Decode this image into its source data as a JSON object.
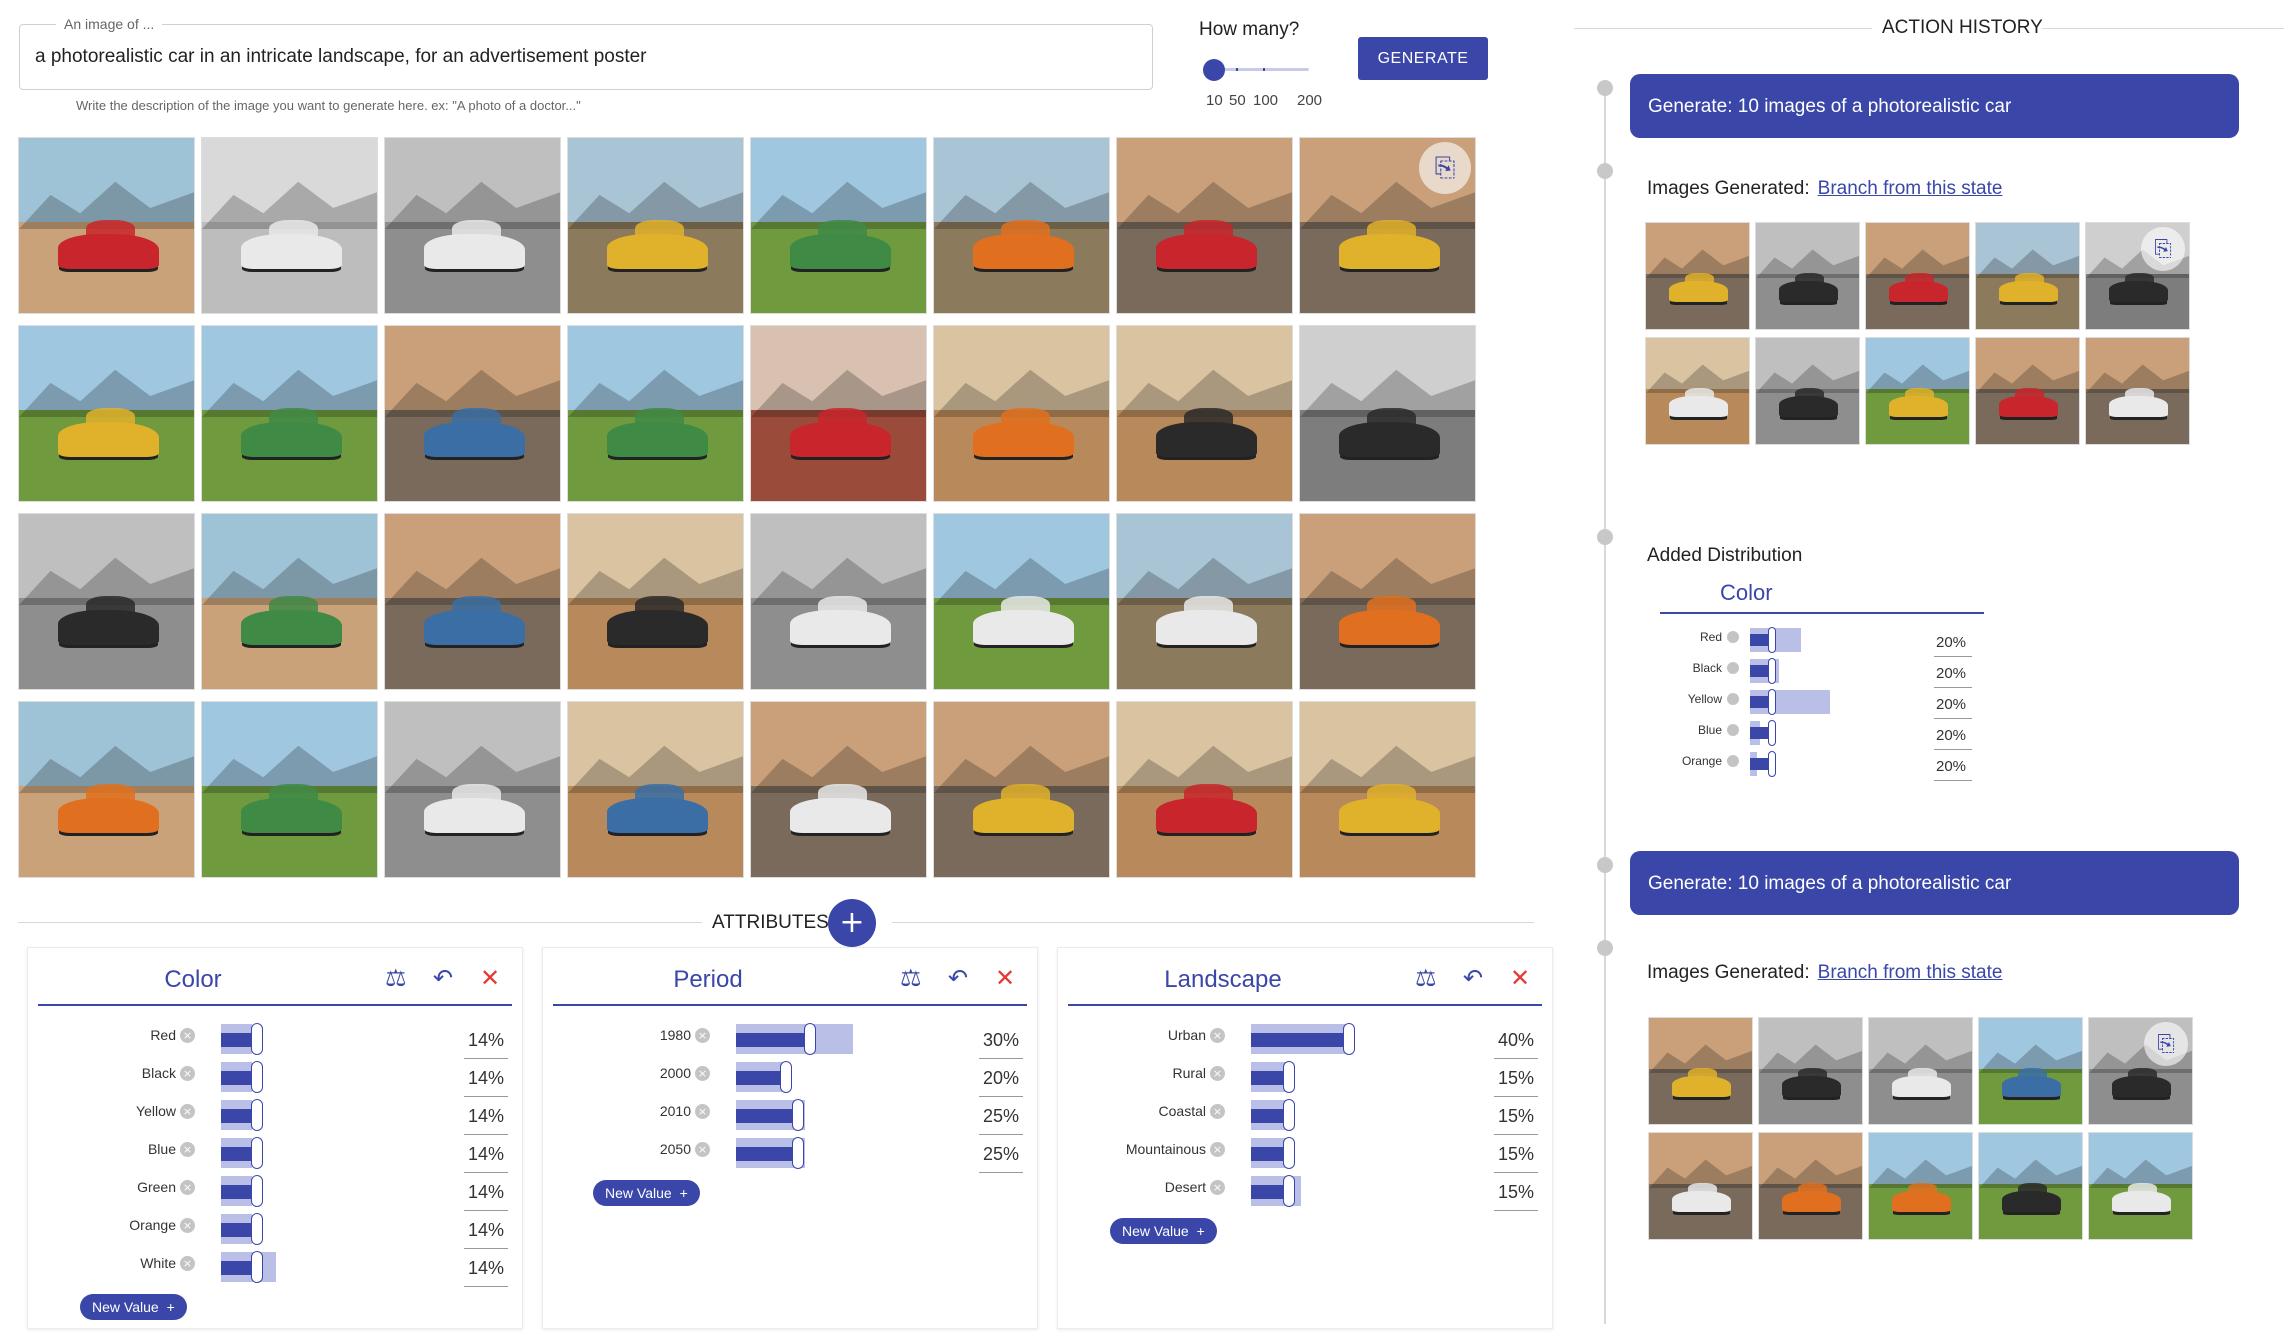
{
  "prompt": {
    "legend": "An image of ...",
    "value": "a photorealistic car in an intricate landscape, for an advertisement poster",
    "helper": "Write the description of the image you want to generate here. ex: \"A photo of a doctor...\""
  },
  "how_many": {
    "label": "How many?",
    "value": 10,
    "tick_labels": [
      "10",
      "50",
      "100",
      "200"
    ]
  },
  "generate_label": "GENERATE",
  "grid_images": [
    {
      "car": "red",
      "scene": "coast"
    },
    {
      "car": "white",
      "scene": "desert-bw"
    },
    {
      "car": "white",
      "scene": "city-bw"
    },
    {
      "car": "yellow",
      "scene": "mountain"
    },
    {
      "car": "green",
      "scene": "field"
    },
    {
      "car": "orange",
      "scene": "mountain"
    },
    {
      "car": "red",
      "scene": "city"
    },
    {
      "car": "yellow",
      "scene": "city"
    },
    {
      "car": "yellow",
      "scene": "field"
    },
    {
      "car": "green",
      "scene": "field"
    },
    {
      "car": "blue",
      "scene": "city"
    },
    {
      "car": "green",
      "scene": "field"
    },
    {
      "car": "red",
      "scene": "clouds"
    },
    {
      "car": "orange",
      "scene": "desert"
    },
    {
      "car": "black",
      "scene": "desert"
    },
    {
      "car": "black",
      "scene": "mountain-bw"
    },
    {
      "car": "black",
      "scene": "city-bw"
    },
    {
      "car": "green",
      "scene": "coast"
    },
    {
      "car": "blue",
      "scene": "city"
    },
    {
      "car": "black",
      "scene": "desert"
    },
    {
      "car": "white",
      "scene": "city-bw"
    },
    {
      "car": "white",
      "scene": "field"
    },
    {
      "car": "white",
      "scene": "mountain"
    },
    {
      "car": "orange",
      "scene": "city"
    },
    {
      "car": "orange",
      "scene": "coast"
    },
    {
      "car": "green",
      "scene": "field"
    },
    {
      "car": "white",
      "scene": "city-bw"
    },
    {
      "car": "blue",
      "scene": "desert"
    },
    {
      "car": "white",
      "scene": "city"
    },
    {
      "car": "yellow",
      "scene": "city"
    },
    {
      "car": "red",
      "scene": "desert"
    },
    {
      "car": "yellow",
      "scene": "desert"
    }
  ],
  "attributes": {
    "title": "ATTRIBUTES",
    "add_icon": "plus-icon",
    "new_value_label": "New Value",
    "panels": [
      {
        "name": "Color",
        "rows": [
          {
            "label": "Red",
            "pct": "14%",
            "value": 14
          },
          {
            "label": "Black",
            "pct": "14%",
            "value": 14
          },
          {
            "label": "Yellow",
            "pct": "14%",
            "value": 14
          },
          {
            "label": "Blue",
            "pct": "14%",
            "value": 14
          },
          {
            "label": "Green",
            "pct": "14%",
            "value": 14
          },
          {
            "label": "Orange",
            "pct": "14%",
            "value": 14
          },
          {
            "label": "White",
            "pct": "14%",
            "value": 14
          }
        ],
        "current": [
          12,
          12,
          12,
          12,
          12,
          12,
          22
        ]
      },
      {
        "name": "Period",
        "rows": [
          {
            "label": "1980",
            "pct": "30%",
            "value": 30
          },
          {
            "label": "2000",
            "pct": "20%",
            "value": 20
          },
          {
            "label": "2010",
            "pct": "25%",
            "value": 25
          },
          {
            "label": "2050",
            "pct": "25%",
            "value": 25
          }
        ],
        "current": [
          48,
          20,
          28,
          28
        ]
      },
      {
        "name": "Landscape",
        "rows": [
          {
            "label": "Urban",
            "pct": "40%",
            "value": 40
          },
          {
            "label": "Rural",
            "pct": "15%",
            "value": 15
          },
          {
            "label": "Coastal",
            "pct": "15%",
            "value": 15
          },
          {
            "label": "Mountainous",
            "pct": "15%",
            "value": 15
          },
          {
            "label": "Desert",
            "pct": "15%",
            "value": 15
          }
        ],
        "current": [
          40,
          15,
          15,
          15,
          20
        ]
      }
    ]
  },
  "history": {
    "title": "ACTION HISTORY",
    "gen1": "Generate: 10 images of a photorealistic car",
    "images_label": "Images Generated:",
    "branch_link": "Branch from this state",
    "added_distribution": "Added Distribution",
    "dist_name": "Color",
    "dist_rows": [
      {
        "label": "Red",
        "pct": "20%",
        "value": 20,
        "current": 36
      },
      {
        "label": "Black",
        "pct": "20%",
        "value": 20,
        "current": 20
      },
      {
        "label": "Yellow",
        "pct": "20%",
        "value": 20,
        "current": 58
      },
      {
        "label": "Blue",
        "pct": "20%",
        "value": 20,
        "current": 6
      },
      {
        "label": "Orange",
        "pct": "20%",
        "value": 20,
        "current": 4
      }
    ],
    "gen2": "Generate: 10 images of a photorealistic car",
    "thumbs1": [
      {
        "car": "yellow",
        "scene": "city"
      },
      {
        "car": "black",
        "scene": "city-bw"
      },
      {
        "car": "red",
        "scene": "city"
      },
      {
        "car": "yellow",
        "scene": "mountain"
      },
      {
        "car": "black",
        "scene": "mountain-bw"
      },
      {
        "car": "white",
        "scene": "desert"
      },
      {
        "car": "black",
        "scene": "city-bw"
      },
      {
        "car": "yellow",
        "scene": "field"
      },
      {
        "car": "red",
        "scene": "city"
      },
      {
        "car": "white",
        "scene": "city"
      }
    ],
    "thumbs2": [
      {
        "car": "yellow",
        "scene": "city"
      },
      {
        "car": "black",
        "scene": "city-bw"
      },
      {
        "car": "white",
        "scene": "city-bw"
      },
      {
        "car": "blue",
        "scene": "field"
      },
      {
        "car": "black",
        "scene": "city-bw"
      },
      {
        "car": "white",
        "scene": "city"
      },
      {
        "car": "orange",
        "scene": "city"
      },
      {
        "car": "orange",
        "scene": "field"
      },
      {
        "car": "black",
        "scene": "field"
      },
      {
        "car": "white",
        "scene": "field"
      }
    ]
  },
  "icons": {
    "balance": "balance-icon",
    "undo": "undo-icon",
    "close": "close-icon",
    "copy": "copy-icon",
    "remove": "remove-value-icon"
  },
  "colors": {
    "accent": "#3a47a8",
    "accent_light": "#b9bfe6",
    "danger": "#e53935",
    "cars": {
      "red": "#c8262c",
      "white": "#e9e9e9",
      "yellow": "#e0b12a",
      "green": "#3f8a45",
      "orange": "#e0701f",
      "blue": "#3a6ea5",
      "black": "#2a2a2a"
    },
    "scenes": {
      "coast": [
        "#9fc3d6",
        "#c9a27a"
      ],
      "desert-bw": [
        "#d9d9d9",
        "#bdbdbd"
      ],
      "city-bw": [
        "#bfbfbf",
        "#8e8e8e"
      ],
      "mountain": [
        "#a9c4d4",
        "#8c7a5c"
      ],
      "field": [
        "#9fc7e0",
        "#6f9a3e"
      ],
      "city": [
        "#c9a07a",
        "#7a6a5c"
      ],
      "clouds": [
        "#d8c1b0",
        "#9a4b3a"
      ],
      "desert": [
        "#d9c3a0",
        "#b8895a"
      ],
      "mountain-bw": [
        "#cfcfcf",
        "#7d7d7d"
      ]
    }
  }
}
